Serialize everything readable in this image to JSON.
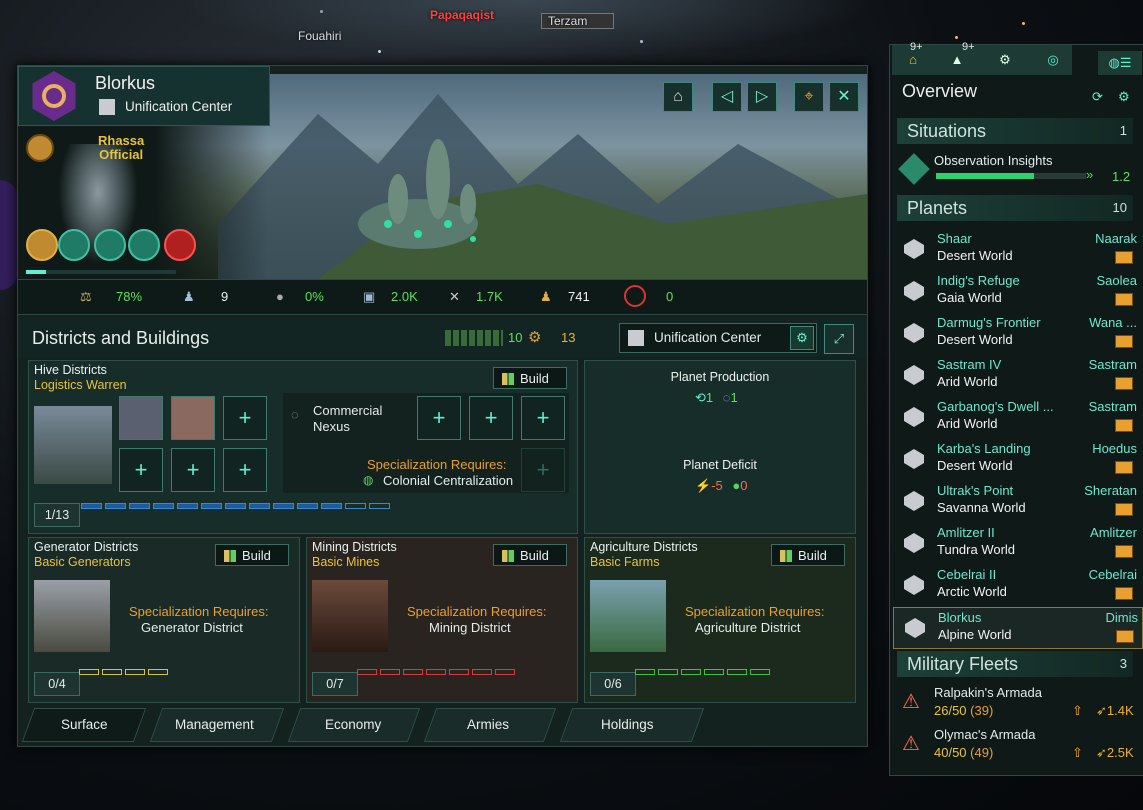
{
  "map": {
    "labels": [
      "Fouahiri",
      "Papaqaqist",
      "Terzam"
    ]
  },
  "planet": {
    "name": "Blorkus",
    "capital": "Unification Center",
    "leader_name": "Rhassa",
    "leader_title": "Official",
    "stats": {
      "stability": "78%",
      "pops": "9",
      "crime": "0%",
      "housing": "2.0K",
      "amenities": "1.7K",
      "jobs": "741",
      "deviancy": "0"
    }
  },
  "districts_header": {
    "title": "Districts and Buildings",
    "district_count": "10",
    "building_slots": "13",
    "capital_building": "Unification Center"
  },
  "hive": {
    "title": "Hive Districts",
    "subtitle": "Logistics Warren",
    "build_label": "Build",
    "building_name": "Commercial Nexus",
    "spec_label": "Specialization Requires:",
    "spec_value": "Colonial Centralization",
    "counter": "1/13",
    "bar_filled": 11,
    "bar_total": 13
  },
  "production": {
    "title": "Planet Production",
    "val1": "1",
    "val2": "1",
    "deficit_title": "Planet Deficit",
    "deficit_energy": "-5",
    "deficit_food": "0"
  },
  "generator": {
    "title": "Generator Districts",
    "subtitle": "Basic Generators",
    "build_label": "Build",
    "spec_label": "Specialization Requires:",
    "spec_value": "Generator District",
    "counter": "0/4",
    "bar_total": 4
  },
  "mining": {
    "title": "Mining Districts",
    "subtitle": "Basic Mines",
    "build_label": "Build",
    "spec_label": "Specialization Requires:",
    "spec_value": "Mining District",
    "counter": "0/7",
    "bar_total": 7
  },
  "agriculture": {
    "title": "Agriculture Districts",
    "subtitle": "Basic Farms",
    "build_label": "Build",
    "spec_label": "Specialization Requires:",
    "spec_value": "Agriculture District",
    "counter": "0/6",
    "bar_total": 6
  },
  "tabs": [
    "Surface",
    "Management",
    "Economy",
    "Armies",
    "Holdings"
  ],
  "outliner": {
    "badge1": "9+",
    "badge2": "9+",
    "overview": "Overview",
    "situations_title": "Situations",
    "situations_count": "1",
    "situation_name": "Observation Insights",
    "situation_rate": "1.2",
    "situation_progress": 0.65,
    "planets_title": "Planets",
    "planets_count": "10",
    "planets": [
      {
        "name": "Shaar",
        "type": "Desert World",
        "sector": "Naarak"
      },
      {
        "name": "Indig's Refuge",
        "type": "Gaia World",
        "sector": "Saolea"
      },
      {
        "name": "Darmug's Frontier",
        "type": "Desert World",
        "sector": "Wana ..."
      },
      {
        "name": "Sastram IV",
        "type": "Arid World",
        "sector": "Sastram"
      },
      {
        "name": "Garbanog's Dwell ...",
        "type": "Arid World",
        "sector": "Sastram"
      },
      {
        "name": "Karba's Landing",
        "type": "Desert World",
        "sector": "Hoedus"
      },
      {
        "name": "Ultrak's Point",
        "type": "Savanna World",
        "sector": "Sheratan"
      },
      {
        "name": "Amlitzer II",
        "type": "Tundra World",
        "sector": "Amlitzer"
      },
      {
        "name": "Cebelrai II",
        "type": "Arctic World",
        "sector": "Cebelrai"
      },
      {
        "name": "Blorkus",
        "type": "Alpine World",
        "sector": "Dimis"
      }
    ],
    "fleets_title": "Military Fleets",
    "fleets_count": "3",
    "fleets": [
      {
        "name": "Ralpakin's Armada",
        "size": "26/50",
        "extra": "(39)",
        "power": "1.4K"
      },
      {
        "name": "Olymac's Armada",
        "size": "40/50",
        "extra": "(49)",
        "power": "2.5K"
      }
    ]
  },
  "colors": {
    "accent": "#5ef0d0",
    "gold": "#e8c43a",
    "positive": "#5fe05a",
    "negative": "#ff6a4a"
  }
}
